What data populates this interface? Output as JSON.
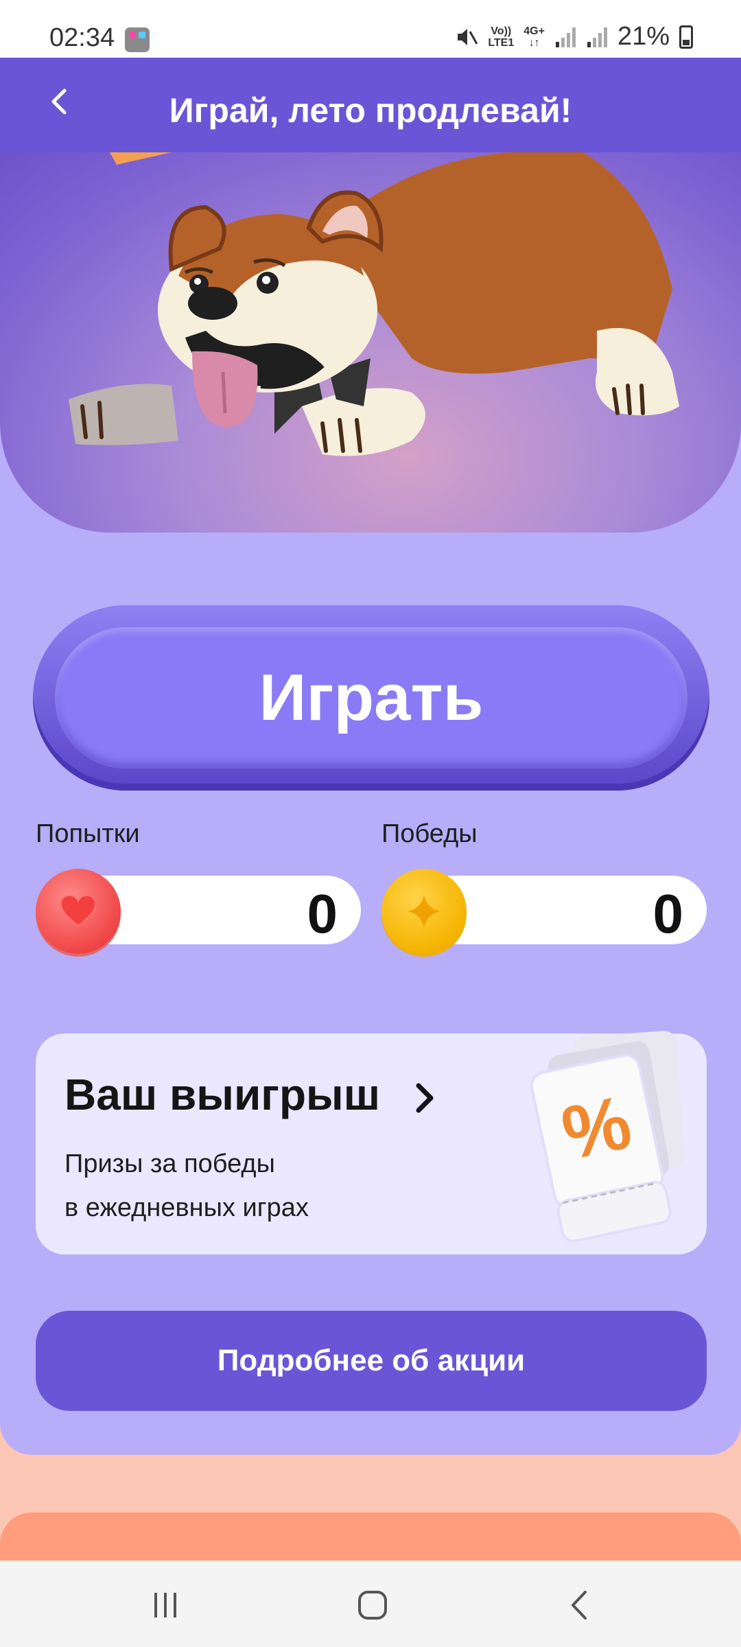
{
  "status_bar": {
    "time": "02:34",
    "network_top": "Vo))",
    "network_bottom": "LTE1",
    "data_top": "4G+",
    "data_bottom": "↓↑",
    "battery": "21%"
  },
  "header": {
    "title": "Играй, лето продлевай!",
    "back_icon": "chevron-left-icon"
  },
  "play_button": {
    "label": "Играть"
  },
  "stats": {
    "attempts": {
      "label": "Попытки",
      "value": "0",
      "icon": "heart-icon"
    },
    "wins": {
      "label": "Победы",
      "value": "0",
      "icon": "coin-star-icon"
    }
  },
  "winnings": {
    "title": "Ваш выигрыш",
    "subtitle_line1": "Призы за победы",
    "subtitle_line2": "в ежедневных играх",
    "badge_symbol": "%"
  },
  "more_button": {
    "label": "Подробнее об акции"
  },
  "nav": {
    "recents_icon": "recents-icon",
    "home_icon": "home-icon",
    "back_icon": "back-icon"
  },
  "colors": {
    "header_bg": "#6a55d6",
    "card_bg": "#b7adf9",
    "play_button": "#8a7af6",
    "winnings_bg": "#ebe7ff",
    "accent_orange": "#ff9d7c"
  }
}
